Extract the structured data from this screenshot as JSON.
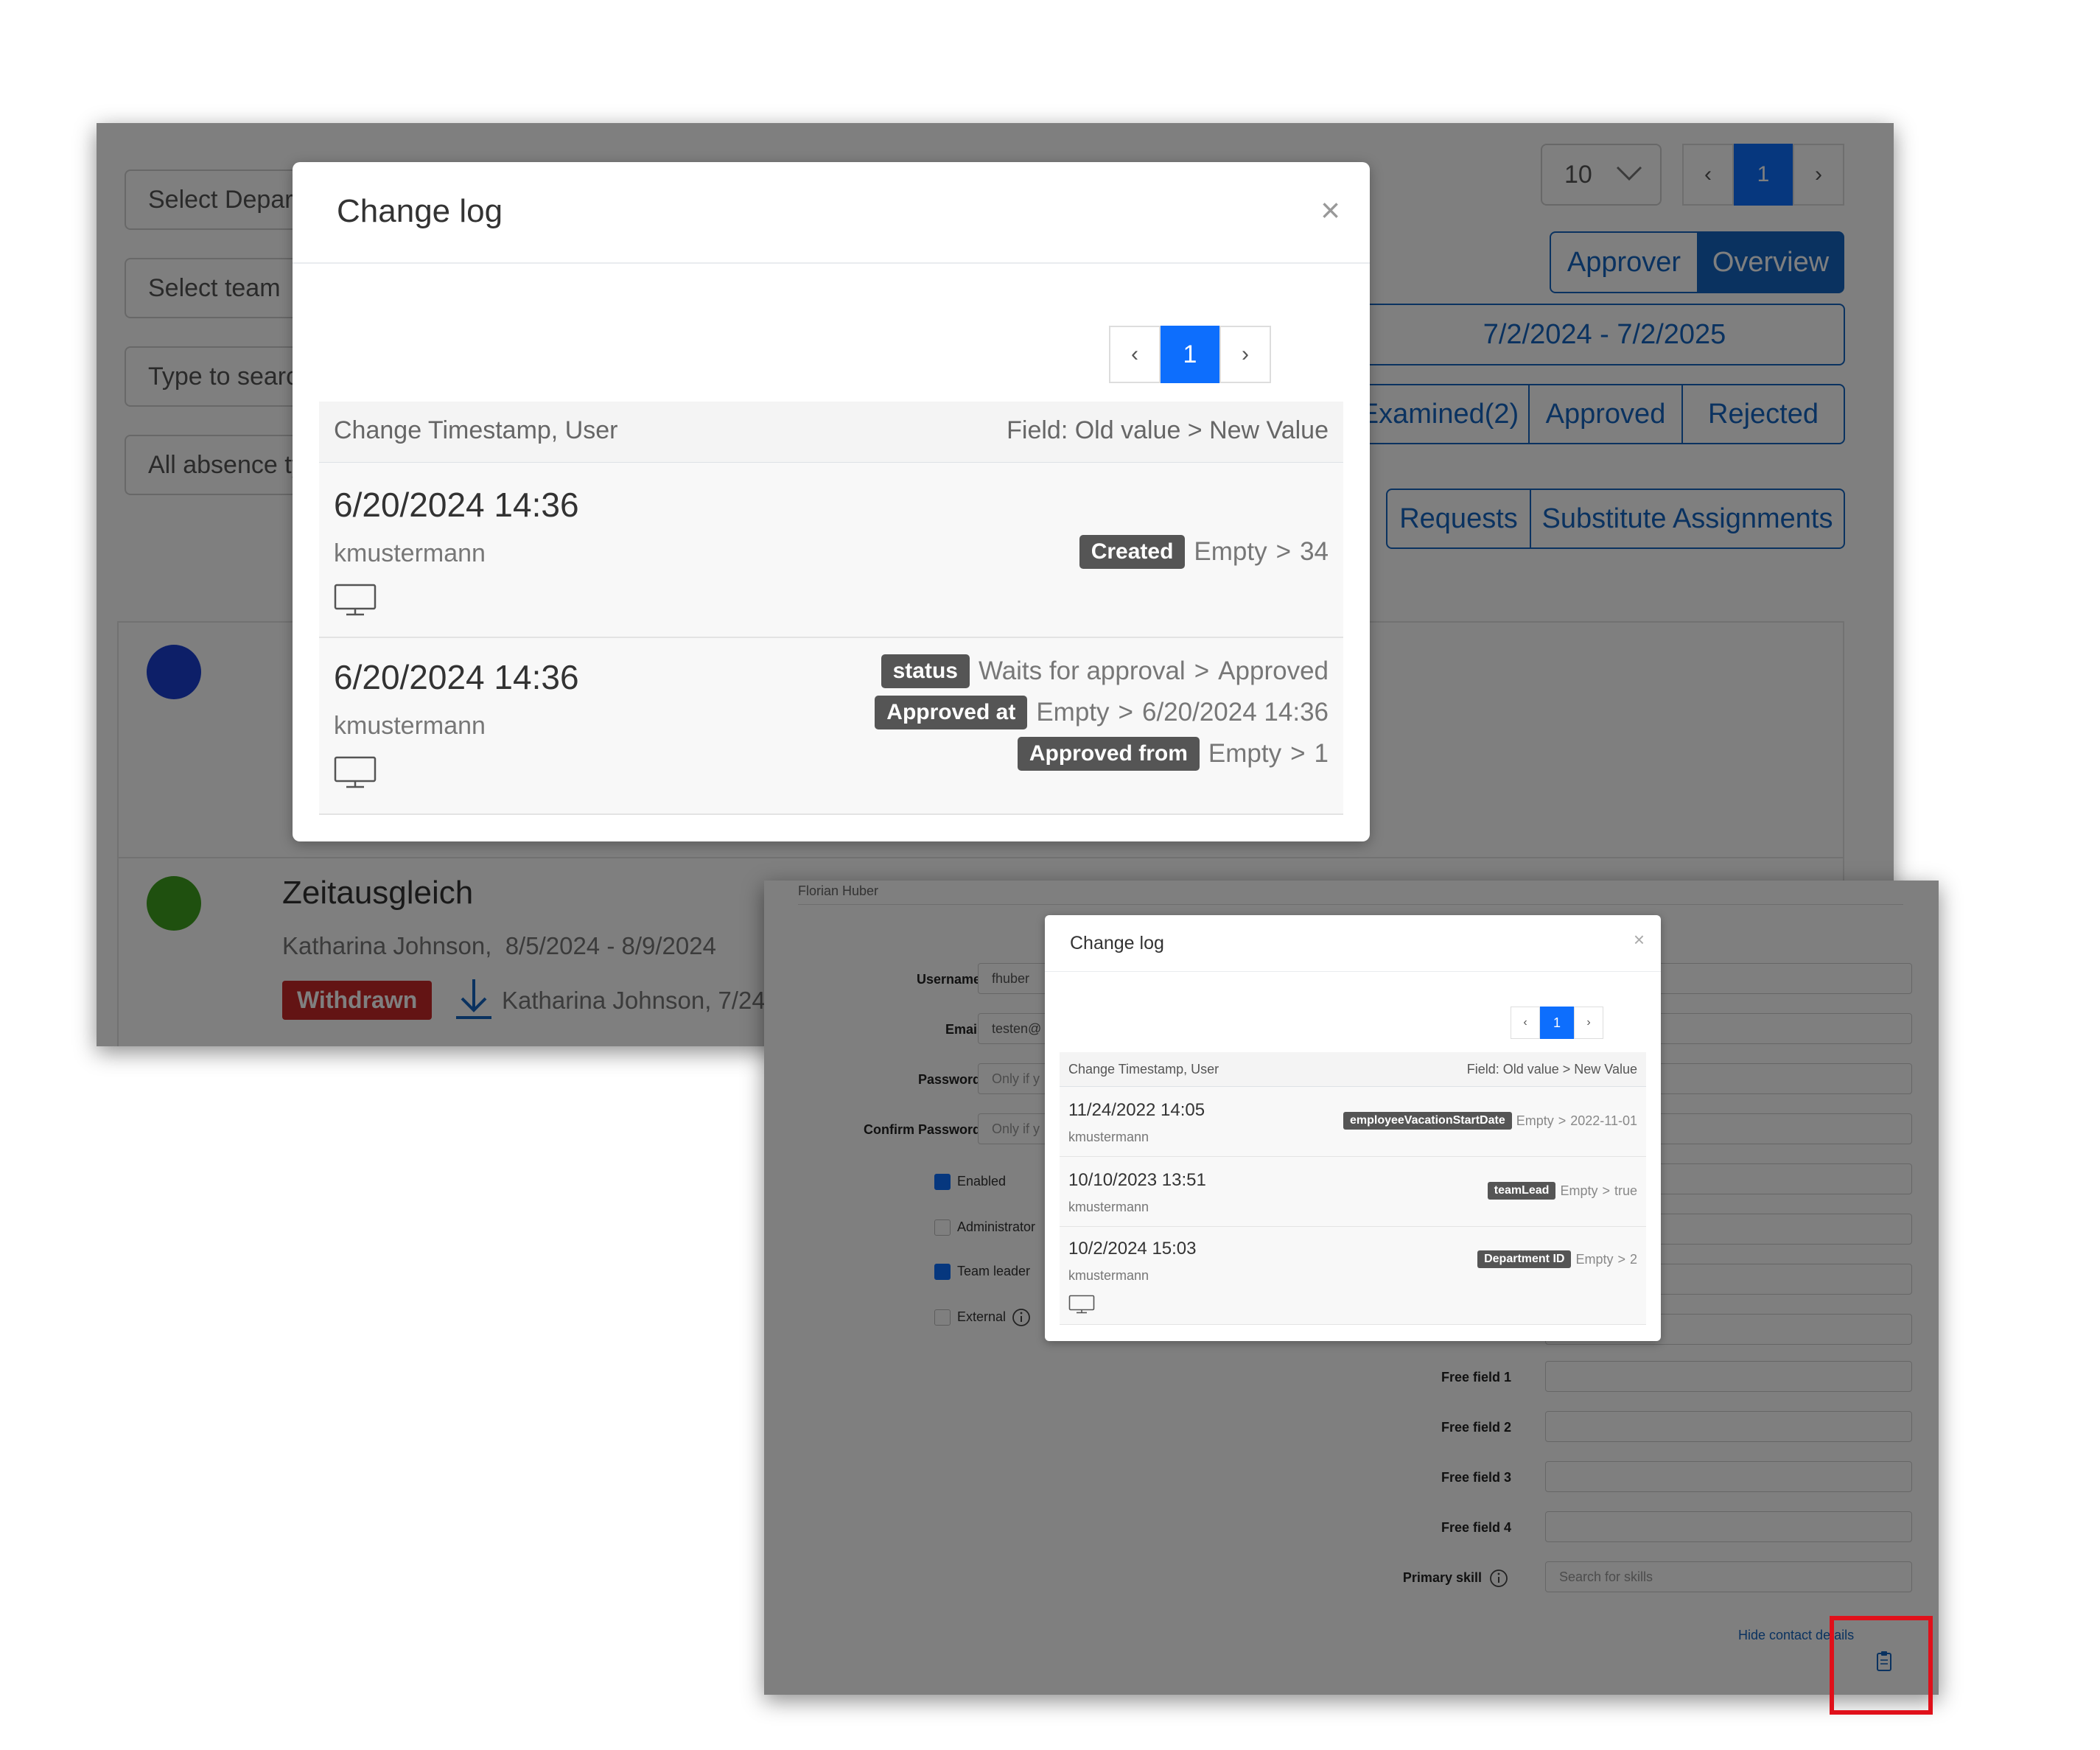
{
  "screen1": {
    "filters": {
      "department_placeholder": "Select Department",
      "team_placeholder": "Select team",
      "search_placeholder": "Type to search",
      "absence_type_value": "All absence types"
    },
    "page_size": "10",
    "pagination": {
      "prev": "‹",
      "current": "1",
      "next": "›"
    },
    "view_buttons": [
      "Approver",
      "Overview"
    ],
    "date_range": "7/2/2024 - 7/2/2025",
    "status_buttons": [
      "Examined(2)",
      "Approved",
      "Rejected"
    ],
    "type_buttons": [
      "Requests",
      "Substitute Assignments"
    ],
    "entries": [
      {
        "title": "Zeitausgleich",
        "subtitle": "Katharina Johnson,  8/5/2024 - 8/9/2024",
        "status_badge": "Withdrawn",
        "history": "Katharina Johnson, 7/24"
      }
    ],
    "colors": {
      "dot_blue": "#1a3fd1",
      "dot_green": "#3fa11f",
      "withdrawn": "#c62828",
      "accent": "#1565c0"
    }
  },
  "modal1": {
    "title": "Change log",
    "close": "×",
    "pagination": {
      "prev": "‹",
      "current": "1",
      "next": "›"
    },
    "header_left": "Change Timestamp, User",
    "header_right": "Field: Old value > New Value",
    "rows": [
      {
        "timestamp": "6/20/2024 14:36",
        "user": "kmustermann",
        "icon": "monitor-icon",
        "changes": [
          {
            "field": "Created",
            "old": "Empty",
            "sep": ">",
            "new": "34"
          }
        ]
      },
      {
        "timestamp": "6/20/2024 14:36",
        "user": "kmustermann",
        "icon": "monitor-icon",
        "changes": [
          {
            "field": "status",
            "old": "Waits for approval",
            "sep": ">",
            "new": "Approved"
          },
          {
            "field": "Approved at",
            "old": "Empty",
            "sep": ">",
            "new": "6/20/2024 14:36"
          },
          {
            "field": "Approved from",
            "old": "Empty",
            "sep": ">",
            "new": "1"
          }
        ]
      }
    ]
  },
  "screen2": {
    "user_name": "Florian Huber",
    "fields": {
      "username_label": "Username",
      "username_value": "fhuber",
      "email_label": "Email",
      "email_value": "testen@",
      "password_label": "Password",
      "password_placeholder": "Only if y",
      "confirm_label": "Confirm Password",
      "confirm_placeholder": "Only if y",
      "free1_label": "Free field 1",
      "free2_label": "Free field 2",
      "free3_label": "Free field 3",
      "free4_label": "Free field 4",
      "primary_skill_label": "Primary skill",
      "skills_placeholder": "Search for skills"
    },
    "checkboxes": [
      {
        "label": "Enabled",
        "checked": true
      },
      {
        "label": "Administrator",
        "checked": false
      },
      {
        "label": "Team leader",
        "checked": true
      },
      {
        "label": "External",
        "checked": false
      }
    ],
    "hide_contact_link": "Hide contact details"
  },
  "modal2": {
    "title": "Change log",
    "close": "×",
    "pagination": {
      "prev": "‹",
      "current": "1",
      "next": "›"
    },
    "header_left": "Change Timestamp, User",
    "header_right": "Field: Old value > New Value",
    "rows": [
      {
        "timestamp": "11/24/2022 14:05",
        "user": "kmustermann",
        "field": "employeeVacationStartDate",
        "old": "Empty",
        "sep": ">",
        "new": "2022-11-01"
      },
      {
        "timestamp": "10/10/2023 13:51",
        "user": "kmustermann",
        "field": "teamLead",
        "old": "Empty",
        "sep": ">",
        "new": "true"
      },
      {
        "timestamp": "10/2/2024 15:03",
        "user": "kmustermann",
        "field": "Department ID",
        "old": "Empty",
        "sep": ">",
        "new": "2",
        "icon": "monitor-icon"
      }
    ]
  }
}
